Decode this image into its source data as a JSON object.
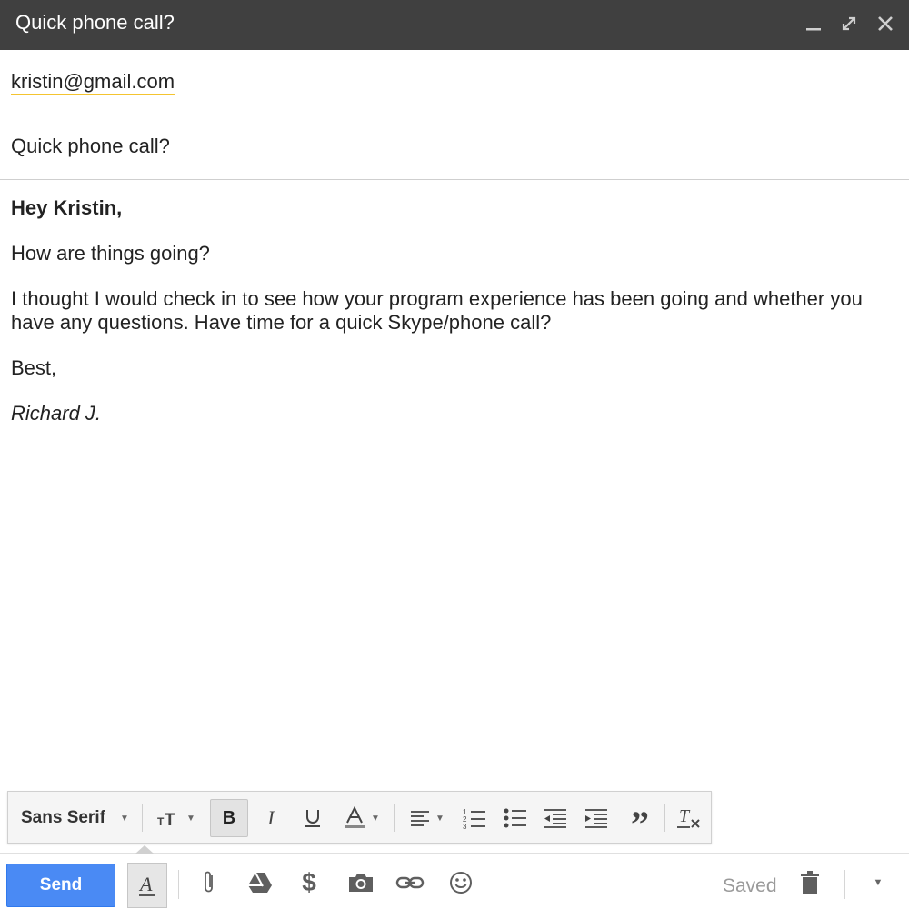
{
  "window": {
    "title": "Quick phone call?",
    "controls": [
      "minimize-icon",
      "pop-out-icon",
      "close-icon"
    ]
  },
  "compose": {
    "recipient": "kristin@gmail.com",
    "subject": "Quick phone call?",
    "body": {
      "greeting": "Hey Kristin,",
      "line1": "How are things going?",
      "line2a": "I thought I would check in to see how your program experience has been going and whether you",
      "line2b": "have any questions. Have time for a quick Skype/phone call?",
      "closing": "Best,",
      "signature": "Richard J."
    }
  },
  "format_toolbar": {
    "font": "Sans Serif",
    "bold_label": "B",
    "icons": [
      "text-size-icon",
      "bold-icon",
      "italic-icon",
      "underline-icon",
      "text-color-icon",
      "align-icon",
      "numbered-list-icon",
      "bulleted-list-icon",
      "indent-less-icon",
      "indent-more-icon",
      "quote-icon",
      "remove-formatting-icon"
    ]
  },
  "bottom_bar": {
    "send_label": "Send",
    "saved_label": "Saved",
    "icons": [
      "formatting-options-icon",
      "attach-icon",
      "drive-icon",
      "money-icon",
      "photo-icon",
      "link-icon",
      "emoji-icon",
      "trash-icon",
      "more-options-icon"
    ]
  },
  "colors": {
    "titlebar": "#404040",
    "send_button": "#4a8af4",
    "recipient_underline": "#f4c430"
  }
}
